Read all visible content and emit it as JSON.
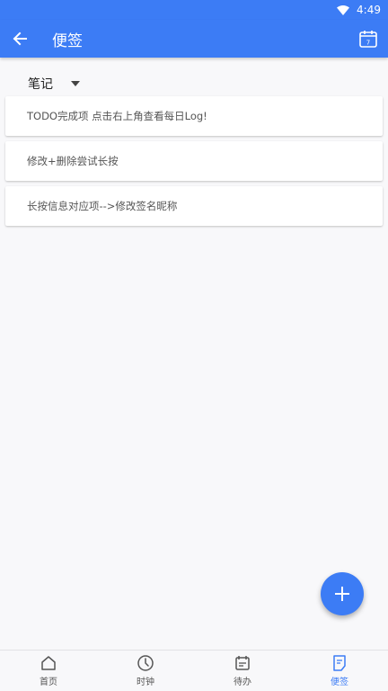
{
  "status_bar": {
    "time": "4:49"
  },
  "app_bar": {
    "title": "便签"
  },
  "category": {
    "selected": "笔记"
  },
  "notes": [
    {
      "text": "TODO完成项 点击右上角查看每日Log!"
    },
    {
      "text": "修改+删除尝试长按"
    },
    {
      "text": "长按信息对应项-->修改签名昵称"
    }
  ],
  "calendar_icon_day": "7",
  "bottom_nav": {
    "items": [
      {
        "label": "首页",
        "icon": "home-icon",
        "active": false
      },
      {
        "label": "时钟",
        "icon": "clock-icon",
        "active": false
      },
      {
        "label": "待办",
        "icon": "todo-icon",
        "active": false
      },
      {
        "label": "便签",
        "icon": "note-icon",
        "active": true
      }
    ]
  },
  "colors": {
    "primary": "#3c7cf5",
    "background": "#f8f8fa",
    "card": "#ffffff"
  }
}
